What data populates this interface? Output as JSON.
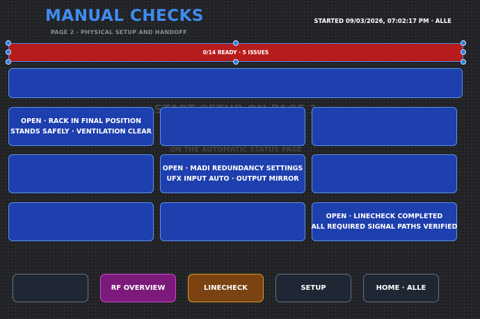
{
  "header": {
    "title": "MANUAL CHECKS",
    "subtitle": "PAGE 2 · PHYSICAL SETUP AND HANDOFF",
    "started": "STARTED 09/03/2026, 07:02:17 PM · ALLE"
  },
  "status_bar": {
    "text": "0/14 READY · 5 ISSUES",
    "color": "#b71c1c"
  },
  "background_hint": {
    "line1": "START SETUP ON PAGE 1",
    "line2": "ON THE AUTOMATIC STATUS PAGE"
  },
  "checks": {
    "top_wide": {
      "line1": "",
      "line2": ""
    },
    "r1c1": {
      "line1": "OPEN · RACK IN FINAL POSITION",
      "line2": "STANDS SAFELY · VENTILATION CLEAR"
    },
    "r1c2": {
      "line1": "",
      "line2": ""
    },
    "r1c3": {
      "line1": "",
      "line2": ""
    },
    "r2c1": {
      "line1": "",
      "line2": ""
    },
    "r2c2": {
      "line1": "OPEN · MADI REDUNDANCY SETTINGS",
      "line2": "UFX INPUT AUTO · OUTPUT MIRROR"
    },
    "r2c3": {
      "line1": "",
      "line2": ""
    },
    "r3c1": {
      "line1": "",
      "line2": ""
    },
    "r3c2": {
      "line1": "",
      "line2": ""
    },
    "r3c3": {
      "line1": "OPEN · LINECHECK COMPLETED",
      "line2": "ALL REQUIRED SIGNAL PATHS VERIFIED"
    }
  },
  "nav": {
    "blank": "",
    "rf_overview": "RF OVERVIEW",
    "linecheck": "LINECHECK",
    "setup": "SETUP",
    "home": "HOME · ALLE"
  },
  "colors": {
    "accent": "#3f8cf0",
    "card": "#1e3fae",
    "rf_overview": "#7b1a7b",
    "linecheck": "#7a4311",
    "nav_default": "#1f2734"
  }
}
